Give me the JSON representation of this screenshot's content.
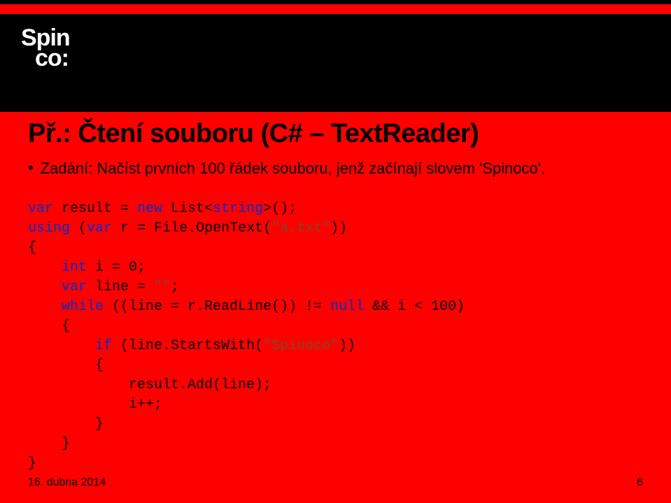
{
  "logo": {
    "line1": "Spin",
    "line2": "co:"
  },
  "title": "Př.: Čtení souboru (C# – TextReader)",
  "subtitle": "Zadání: Načíst prvních 100 řádek souboru, jenž začínají slovem 'Spinoco'.",
  "code": {
    "t1": "var",
    "t2": " result = ",
    "t3": "new",
    "t4": " List<",
    "t5": "string",
    "t6": ">();",
    "l2a": "using",
    "l2b": " (",
    "l2c": "var",
    "l2d": " r = File.OpenText(",
    "l2e": "\"a.txt\"",
    "l2f": "))",
    "l3": "{",
    "l4a": "    int",
    "l4b": " i = 0;",
    "l5a": "    var",
    "l5b": " line = ",
    "l5c": "\"\"",
    "l5d": ";",
    "l6a": "    while",
    "l6b": " ((line = r.ReadLine()) != ",
    "l6c": "null",
    "l6d": " && i < 100)",
    "l7": "    {",
    "l8a": "        if",
    "l8b": " (line.StartsWith(",
    "l8c": "\"Spinoco\"",
    "l8d": "))",
    "l9": "        {",
    "l10": "            result.Add(line);",
    "l11": "            i++;",
    "l12": "        }",
    "l13": "    }",
    "l14": "}"
  },
  "footer": {
    "date": "16. dubna 2014",
    "page": "6"
  }
}
